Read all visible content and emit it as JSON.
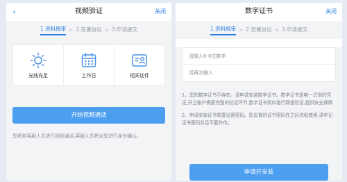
{
  "left": {
    "header": {
      "title": "视频验证",
      "close_label": "关闭"
    },
    "steps": [
      "1.资料报审",
      "2.签署协议",
      "3.申请提交"
    ],
    "features": [
      {
        "icon": "sun-icon",
        "label": "光线充足"
      },
      {
        "icon": "calendar-icon",
        "label": "工作日"
      },
      {
        "icon": "id-card-icon",
        "label": "相关证件"
      }
    ],
    "start_button_label": "开始视频通话",
    "notice": "您将和客服人员进行视频通话,客服人员将对您进行身份确认。"
  },
  "right": {
    "header": {
      "title": "数字证书",
      "close_label": "关闭"
    },
    "steps": [
      "1.资料报审",
      "2.签署协议",
      "3.申请提交"
    ],
    "password_placeholder": "请输入6-8位数字",
    "confirm_placeholder": "请再次输入",
    "desc_1": "1、您的数字证书不存在。请申请安装数字证书。数字证书是唯一识别的凭证,开立账户需要完整的验证环节,数字证书类似银行网银验证,提供安全保障",
    "desc_2": "2、申请安装证书需要设置密码。您设置的证书密码在之后流程使用,请牢记证书密码并且不要外传。",
    "apply_button_label": "申请并安装"
  },
  "colors": {
    "accent": "#2b7fe0",
    "button": "#4c9ef0",
    "background": "#e6eaf2"
  }
}
